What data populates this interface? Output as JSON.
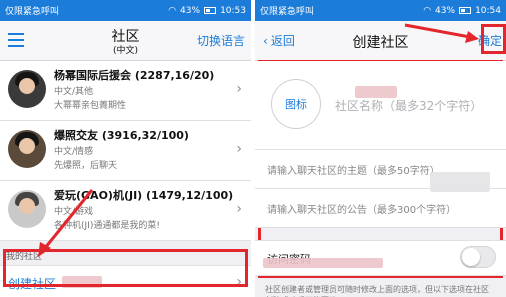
{
  "left": {
    "status": {
      "carrier": "仅限紧急呼叫",
      "battery": "43%",
      "time": "10:53"
    },
    "nav": {
      "title": "社区",
      "subtitle": "(中文)",
      "lang_button": "切换语言",
      "menu_icon": "menu-icon"
    },
    "communities": [
      {
        "name": "杨幂国际后援会 (2287,16/20)",
        "category": "中文/其他",
        "desc": "大幂幂亲包菁期性"
      },
      {
        "name": "爆照交友 (3916,32/100)",
        "category": "中文/情感",
        "desc": "先爆照，后聊天"
      },
      {
        "name": "爱玩(GAO)机(JI) (1479,12/100)",
        "category": "中文/游戏",
        "desc": "各种机(JI)通通都是我的菜!"
      }
    ],
    "my_section": "我的社区",
    "create_label": "创建社区"
  },
  "right": {
    "status": {
      "carrier": "仅限紧急呼叫",
      "battery": "43%",
      "time": "10:54"
    },
    "nav": {
      "back": "返回",
      "title": "创建社区",
      "confirm": "确定"
    },
    "icon_label": "图标",
    "name_placeholder": "社区名称（最多32个字符）",
    "topic_placeholder": "请输入聊天社区的主题（最多50字符）",
    "notice_placeholder": "请输入聊天社区的公告（最多300个字符）",
    "password_label": "访问密码",
    "password_enabled": false,
    "note": "社区创建者或管理员可随时修改上面的选项，但以下选项在社区创建成功后不能更改:"
  },
  "colors": {
    "accent": "#1c7cd9",
    "highlight": "#e3262b"
  }
}
